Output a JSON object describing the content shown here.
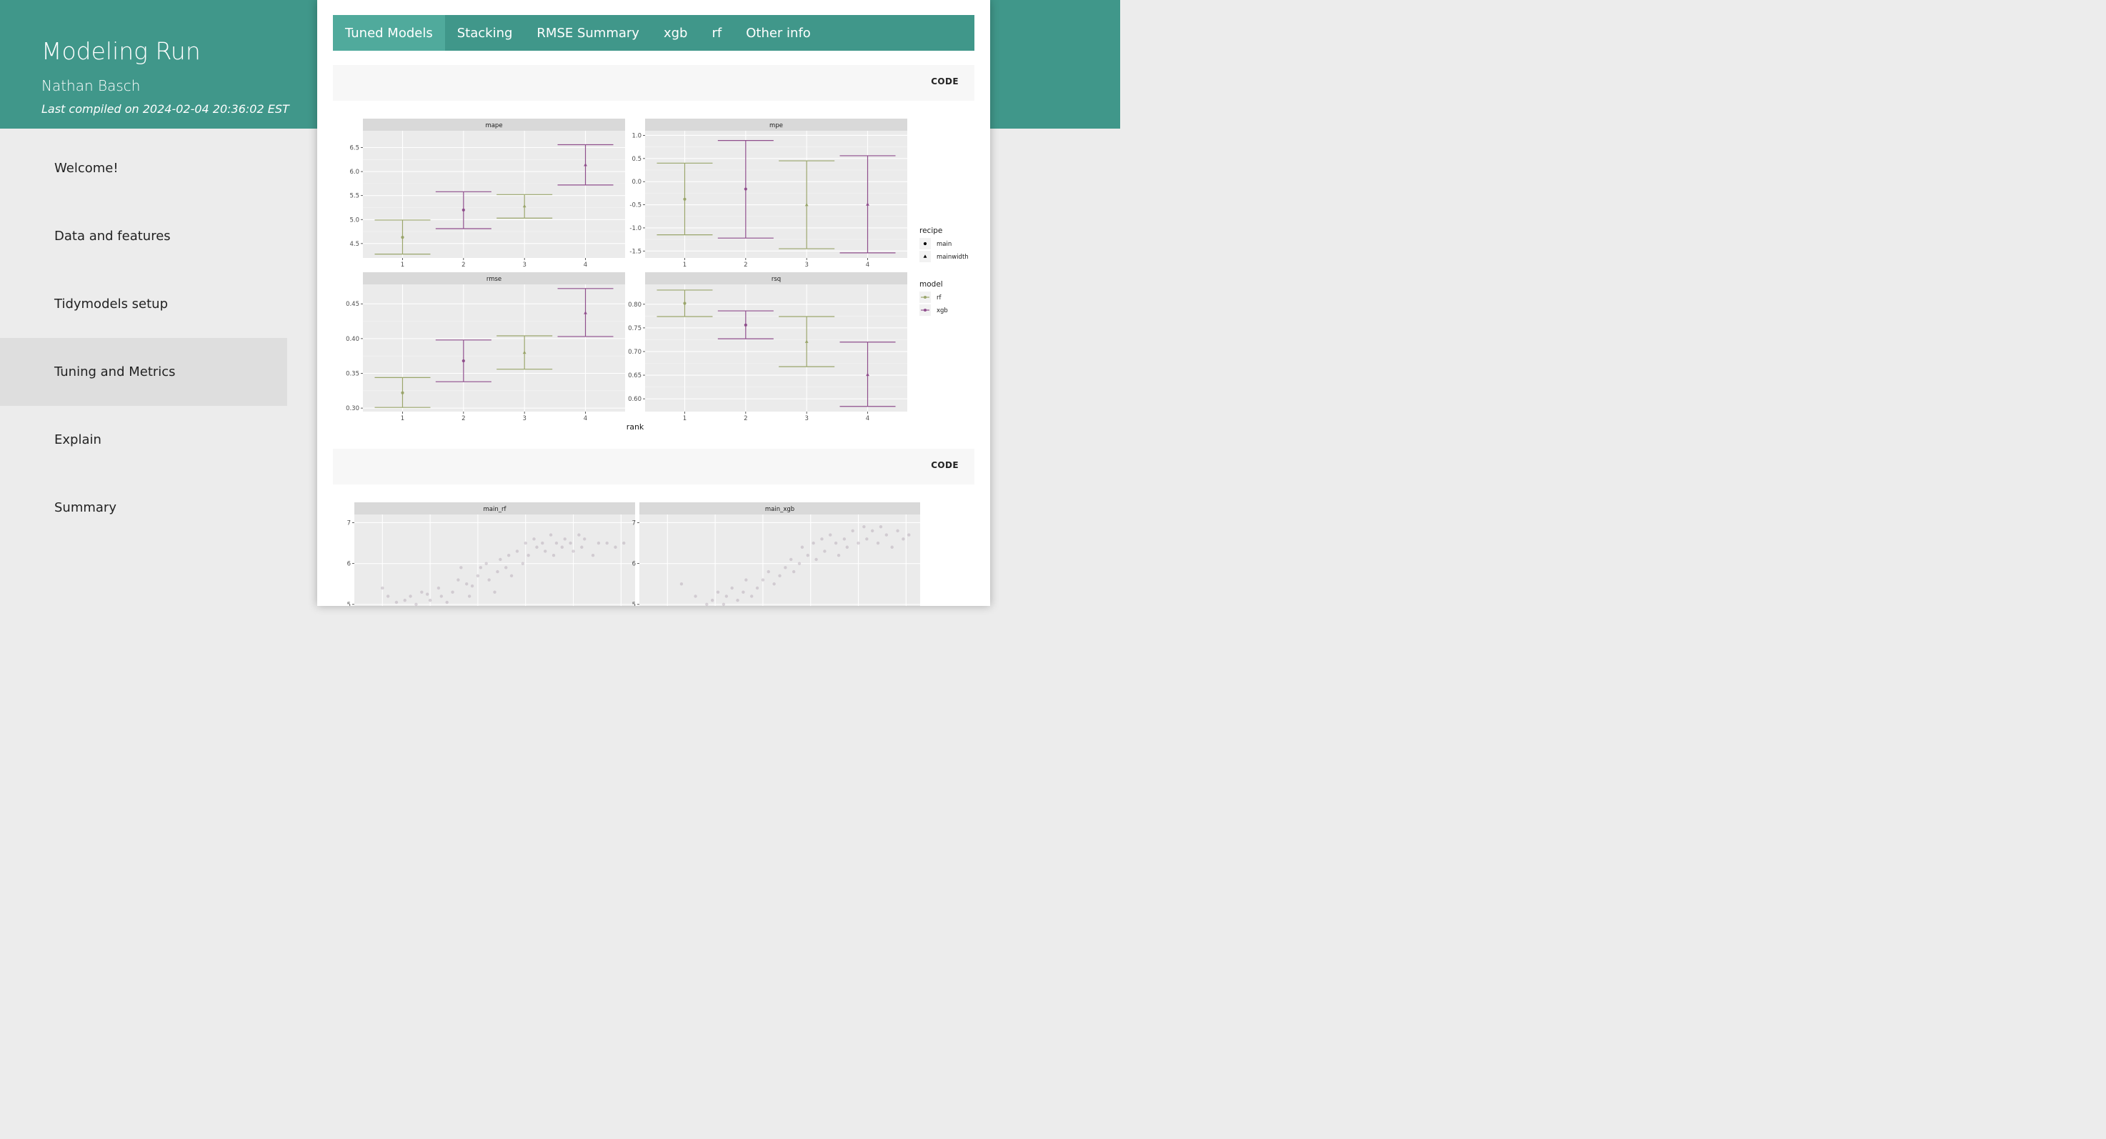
{
  "header": {
    "title": "Modeling Run",
    "author": "Nathan Basch",
    "compiled": "Last compiled on 2024-02-04 20:36:02 EST"
  },
  "nav": {
    "items": [
      {
        "label": "Welcome!"
      },
      {
        "label": "Data and features"
      },
      {
        "label": "Tidymodels setup"
      },
      {
        "label": "Tuning and Metrics",
        "active": true
      },
      {
        "label": "Explain"
      },
      {
        "label": "Summary"
      }
    ]
  },
  "tabs": [
    {
      "label": "Tuned Models",
      "active": true
    },
    {
      "label": "Stacking"
    },
    {
      "label": "RMSE Summary"
    },
    {
      "label": "xgb"
    },
    {
      "label": "rf"
    },
    {
      "label": "Other info"
    }
  ],
  "code_buttons": [
    "CODE",
    "CODE"
  ],
  "colors": {
    "rf": "#9aa56b",
    "xgb": "#8f4e8c",
    "accent": "#40978a"
  },
  "chart_data": [
    {
      "type": "errorbar",
      "xlabel": "rank",
      "ylabel": "",
      "legend": {
        "position": "right",
        "recipe": {
          "title": "recipe",
          "entries": [
            "main",
            "mainwidth"
          ]
        },
        "model": {
          "title": "model",
          "entries": [
            "rf",
            "xgb"
          ]
        }
      },
      "panels": [
        {
          "title": "mape",
          "ticks": [
            4.5,
            5.0,
            5.5,
            6.0,
            6.5
          ],
          "ylim": [
            4.2,
            6.85
          ],
          "points": [
            {
              "rank": 1,
              "mean": 4.63,
              "lo": 4.28,
              "hi": 4.99,
              "model": "rf",
              "recipe": "main"
            },
            {
              "rank": 2,
              "mean": 5.2,
              "lo": 4.81,
              "hi": 5.58,
              "model": "xgb",
              "recipe": "main"
            },
            {
              "rank": 3,
              "mean": 5.28,
              "lo": 5.03,
              "hi": 5.52,
              "model": "rf",
              "recipe": "mainwidth"
            },
            {
              "rank": 4,
              "mean": 6.14,
              "lo": 5.72,
              "hi": 6.56,
              "model": "xgb",
              "recipe": "mainwidth"
            }
          ]
        },
        {
          "title": "mpe",
          "ticks": [
            -1.5,
            -1.0,
            -0.5,
            0.0,
            0.5,
            1.0
          ],
          "ylim": [
            -1.65,
            1.1
          ],
          "points": [
            {
              "rank": 1,
              "mean": -0.38,
              "lo": -1.15,
              "hi": 0.4,
              "model": "rf",
              "recipe": "main"
            },
            {
              "rank": 2,
              "mean": -0.16,
              "lo": -1.22,
              "hi": 0.89,
              "model": "xgb",
              "recipe": "main"
            },
            {
              "rank": 3,
              "mean": -0.5,
              "lo": -1.45,
              "hi": 0.45,
              "model": "rf",
              "recipe": "mainwidth"
            },
            {
              "rank": 4,
              "mean": -0.49,
              "lo": -1.54,
              "hi": 0.56,
              "model": "xgb",
              "recipe": "mainwidth"
            }
          ]
        },
        {
          "title": "rmse",
          "ticks": [
            0.3,
            0.35,
            0.4,
            0.45
          ],
          "ylim": [
            0.295,
            0.478
          ],
          "points": [
            {
              "rank": 1,
              "mean": 0.322,
              "lo": 0.301,
              "hi": 0.344,
              "model": "rf",
              "recipe": "main"
            },
            {
              "rank": 2,
              "mean": 0.368,
              "lo": 0.338,
              "hi": 0.398,
              "model": "xgb",
              "recipe": "main"
            },
            {
              "rank": 3,
              "mean": 0.38,
              "lo": 0.356,
              "hi": 0.404,
              "model": "rf",
              "recipe": "mainwidth"
            },
            {
              "rank": 4,
              "mean": 0.437,
              "lo": 0.403,
              "hi": 0.472,
              "model": "xgb",
              "recipe": "mainwidth"
            }
          ]
        },
        {
          "title": "rsq",
          "ticks": [
            0.6,
            0.65,
            0.7,
            0.75,
            0.8
          ],
          "ylim": [
            0.573,
            0.842
          ],
          "points": [
            {
              "rank": 1,
              "mean": 0.802,
              "lo": 0.774,
              "hi": 0.83,
              "model": "rf",
              "recipe": "main"
            },
            {
              "rank": 2,
              "mean": 0.756,
              "lo": 0.727,
              "hi": 0.786,
              "model": "xgb",
              "recipe": "main"
            },
            {
              "rank": 3,
              "mean": 0.721,
              "lo": 0.668,
              "hi": 0.774,
              "model": "rf",
              "recipe": "mainwidth"
            },
            {
              "rank": 4,
              "mean": 0.651,
              "lo": 0.584,
              "hi": 0.72,
              "model": "xgb",
              "recipe": "mainwidth"
            }
          ]
        }
      ]
    },
    {
      "type": "scatter",
      "panels": [
        {
          "title": "main_rf",
          "ticks": [
            5,
            6,
            7
          ],
          "ylim": [
            4.7,
            7.2
          ],
          "points": [
            [
              0.1,
              5.4
            ],
            [
              0.12,
              5.2
            ],
            [
              0.15,
              5.05
            ],
            [
              0.18,
              5.1
            ],
            [
              0.2,
              5.2
            ],
            [
              0.22,
              5.0
            ],
            [
              0.24,
              5.3
            ],
            [
              0.26,
              5.25
            ],
            [
              0.27,
              5.1
            ],
            [
              0.3,
              5.4
            ],
            [
              0.31,
              5.2
            ],
            [
              0.33,
              5.05
            ],
            [
              0.35,
              5.3
            ],
            [
              0.37,
              5.6
            ],
            [
              0.38,
              5.9
            ],
            [
              0.4,
              5.5
            ],
            [
              0.41,
              5.2
            ],
            [
              0.42,
              5.45
            ],
            [
              0.44,
              5.7
            ],
            [
              0.45,
              5.9
            ],
            [
              0.47,
              6.0
            ],
            [
              0.48,
              5.6
            ],
            [
              0.5,
              5.3
            ],
            [
              0.51,
              5.8
            ],
            [
              0.52,
              6.1
            ],
            [
              0.54,
              5.9
            ],
            [
              0.55,
              6.2
            ],
            [
              0.56,
              5.7
            ],
            [
              0.58,
              6.3
            ],
            [
              0.6,
              6.0
            ],
            [
              0.61,
              6.5
            ],
            [
              0.62,
              6.2
            ],
            [
              0.64,
              6.6
            ],
            [
              0.65,
              6.4
            ],
            [
              0.67,
              6.5
            ],
            [
              0.68,
              6.3
            ],
            [
              0.7,
              6.7
            ],
            [
              0.71,
              6.2
            ],
            [
              0.72,
              6.5
            ],
            [
              0.74,
              6.4
            ],
            [
              0.75,
              6.6
            ],
            [
              0.77,
              6.5
            ],
            [
              0.78,
              6.3
            ],
            [
              0.8,
              6.7
            ],
            [
              0.81,
              6.4
            ],
            [
              0.82,
              6.6
            ],
            [
              0.85,
              6.2
            ],
            [
              0.87,
              6.5
            ],
            [
              0.9,
              6.5
            ],
            [
              0.93,
              6.4
            ],
            [
              0.96,
              6.5
            ]
          ]
        },
        {
          "title": "main_xgb",
          "ticks": [
            5,
            6,
            7
          ],
          "ylim": [
            4.7,
            7.2
          ],
          "points": [
            [
              0.15,
              5.5
            ],
            [
              0.2,
              5.2
            ],
            [
              0.24,
              5.0
            ],
            [
              0.26,
              5.1
            ],
            [
              0.28,
              5.3
            ],
            [
              0.3,
              5.0
            ],
            [
              0.31,
              5.2
            ],
            [
              0.33,
              5.4
            ],
            [
              0.35,
              5.1
            ],
            [
              0.37,
              5.3
            ],
            [
              0.38,
              5.6
            ],
            [
              0.4,
              5.2
            ],
            [
              0.42,
              5.4
            ],
            [
              0.44,
              5.6
            ],
            [
              0.46,
              5.8
            ],
            [
              0.48,
              5.5
            ],
            [
              0.5,
              5.7
            ],
            [
              0.52,
              5.9
            ],
            [
              0.54,
              6.1
            ],
            [
              0.55,
              5.8
            ],
            [
              0.57,
              6.0
            ],
            [
              0.58,
              6.4
            ],
            [
              0.6,
              6.2
            ],
            [
              0.62,
              6.5
            ],
            [
              0.63,
              6.1
            ],
            [
              0.65,
              6.6
            ],
            [
              0.66,
              6.3
            ],
            [
              0.68,
              6.7
            ],
            [
              0.7,
              6.5
            ],
            [
              0.71,
              6.2
            ],
            [
              0.73,
              6.6
            ],
            [
              0.74,
              6.4
            ],
            [
              0.76,
              6.8
            ],
            [
              0.78,
              6.5
            ],
            [
              0.8,
              6.9
            ],
            [
              0.81,
              6.6
            ],
            [
              0.83,
              6.8
            ],
            [
              0.85,
              6.5
            ],
            [
              0.86,
              6.9
            ],
            [
              0.88,
              6.7
            ],
            [
              0.9,
              6.4
            ],
            [
              0.92,
              6.8
            ],
            [
              0.94,
              6.6
            ],
            [
              0.96,
              6.7
            ]
          ]
        }
      ]
    }
  ]
}
